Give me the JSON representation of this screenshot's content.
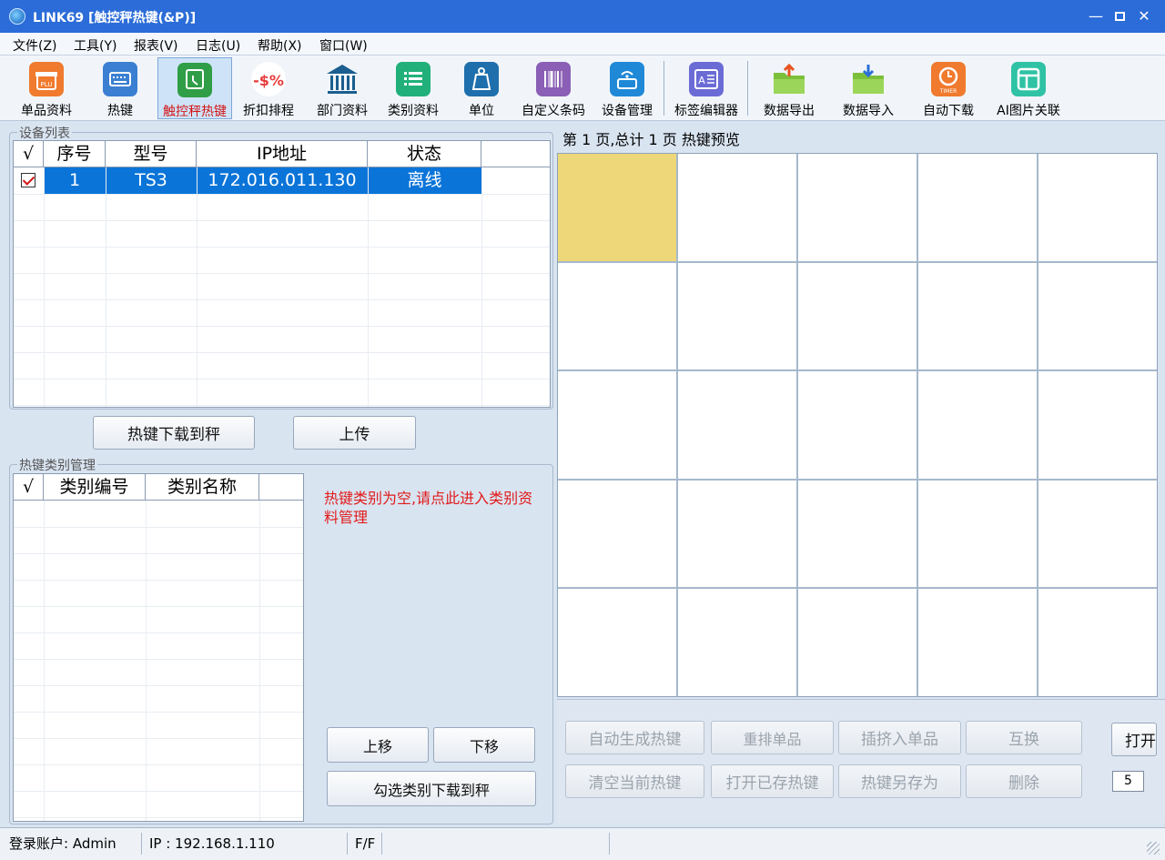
{
  "window": {
    "title": "LINK69 [触控秤热键(&P)]",
    "min_glyph": "—",
    "close_glyph": "✕"
  },
  "menu": [
    "文件(Z)",
    "工具(Y)",
    "报表(V)",
    "日志(U)",
    "帮助(X)",
    "窗口(W)"
  ],
  "toolbar": [
    {
      "label": "单品资料",
      "icon": "gift-plu-icon",
      "color": "#f07a2e"
    },
    {
      "label": "热键",
      "icon": "keyboard-icon",
      "color": "#3a7fd1"
    },
    {
      "label": "触控秤热键",
      "icon": "touch-scale-icon",
      "color": "#2f9e46",
      "active": true
    },
    {
      "label": "折扣排程",
      "icon": "discount-icon",
      "color": "#e83b3b",
      "glyph": "-$%"
    },
    {
      "label": "部门资料",
      "icon": "building-icon",
      "color": "#1b5e8f"
    },
    {
      "label": "类别资料",
      "icon": "list-icon",
      "color": "#21b07a"
    },
    {
      "label": "单位",
      "icon": "weight-icon",
      "color": "#1f6fad"
    },
    {
      "label": "自定义条码",
      "icon": "barcode-icon",
      "color": "#8a5fb5"
    },
    {
      "label": "设备管理",
      "icon": "device-icon",
      "color": "#1f89d8"
    },
    {
      "label": "标签编辑器",
      "icon": "label-editor-icon",
      "color": "#6b6bd6"
    },
    {
      "label": "数据导出",
      "icon": "folder-export-icon",
      "color": "#7cbf3a"
    },
    {
      "label": "数据导入",
      "icon": "folder-import-icon",
      "color": "#7cbf3a"
    },
    {
      "label": "自动下载",
      "icon": "timer-icon",
      "color": "#f07a2e",
      "sub": "TIMER"
    },
    {
      "label": "AI图片关联",
      "icon": "image-link-icon",
      "color": "#2fc2a5"
    }
  ],
  "device_list": {
    "title": "设备列表",
    "columns": [
      "√",
      "序号",
      "型号",
      "IP地址",
      "状态"
    ],
    "rows": [
      {
        "checked": true,
        "index": "1",
        "model": "TS3",
        "ip": "172.016.011.130",
        "status": "离线"
      }
    ]
  },
  "device_buttons": {
    "download": "热键下载到秤",
    "upload": "上传"
  },
  "category": {
    "title": "热键类别管理",
    "columns": [
      "√",
      "类别编号",
      "类别名称"
    ],
    "hint": "热键类别为空,请点此进入类别资料管理",
    "move_up": "上移",
    "move_down": "下移",
    "download_checked": "勾选类别下载到秤"
  },
  "preview": {
    "header": "第 1 页,总计 1 页  热键预览",
    "rows": 5,
    "cols": 5
  },
  "actions": {
    "auto_generate": "自动生成热键",
    "reorder": "重排单品",
    "insert": "插挤入单品",
    "swap": "互换",
    "open": "打开",
    "clear": "清空当前热键",
    "open_saved": "打开已存热键",
    "save_as": "热键另存为",
    "delete": "删除",
    "page_value": "5"
  },
  "status": {
    "account": "登录账户: Admin",
    "ip": "IP : 192.168.1.110",
    "flag": "F/F"
  }
}
